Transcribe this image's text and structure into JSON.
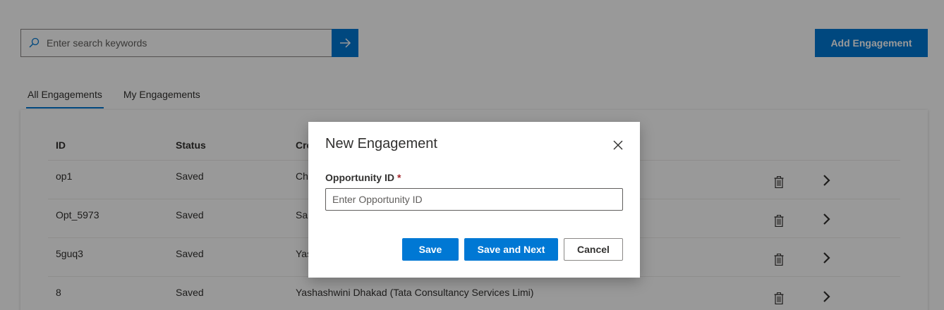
{
  "search": {
    "placeholder": "Enter search keywords"
  },
  "toolbar": {
    "add_label": "Add Engagement"
  },
  "tabs": [
    {
      "label": "All Engagements",
      "active": true
    },
    {
      "label": "My Engagements",
      "active": false
    }
  ],
  "table": {
    "columns": [
      "ID",
      "Status",
      "Cre"
    ],
    "rows": [
      {
        "id": "op1",
        "status": "Saved",
        "created_by": "Ch"
      },
      {
        "id": "Opt_5973",
        "status": "Saved",
        "created_by": "Sa"
      },
      {
        "id": "5guq3",
        "status": "Saved",
        "created_by": "Yas"
      },
      {
        "id": "8",
        "status": "Saved",
        "created_by": "Yashashwini Dhakad (Tata Consultancy Services Limi)"
      }
    ]
  },
  "dialog": {
    "title": "New Engagement",
    "field_label": "Opportunity ID",
    "required_mark": "*",
    "input_placeholder": "Enter Opportunity ID",
    "input_value": "",
    "save_label": "Save",
    "save_next_label": "Save and Next",
    "cancel_label": "Cancel"
  },
  "colors": {
    "accent": "#0078d4",
    "required": "#a4262c"
  },
  "icons": [
    "search-icon",
    "arrow-right-icon",
    "trash-icon",
    "chevron-right-icon",
    "close-icon"
  ]
}
